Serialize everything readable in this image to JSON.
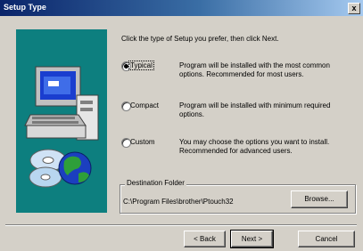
{
  "window": {
    "title": "Setup Type",
    "close_glyph": "x"
  },
  "intro": "Click the type of Setup you prefer, then click Next.",
  "options": [
    {
      "label": "Typical",
      "selected": true,
      "description": "Program will be installed with the most common options. Recommended for most users."
    },
    {
      "label": "Compact",
      "selected": false,
      "description": "Program will be installed with minimum required options."
    },
    {
      "label": "Custom",
      "selected": false,
      "description": "You may choose the options you want to install. Recommended for advanced users."
    }
  ],
  "destination": {
    "legend": "Destination Folder",
    "path": "C:\\Program Files\\brother\\Ptouch32",
    "browse_label": "Browse..."
  },
  "buttons": {
    "back": "< Back",
    "next": "Next >",
    "cancel": "Cancel"
  },
  "icons": {
    "illustration": "computer-with-globe-and-cd-icon"
  }
}
